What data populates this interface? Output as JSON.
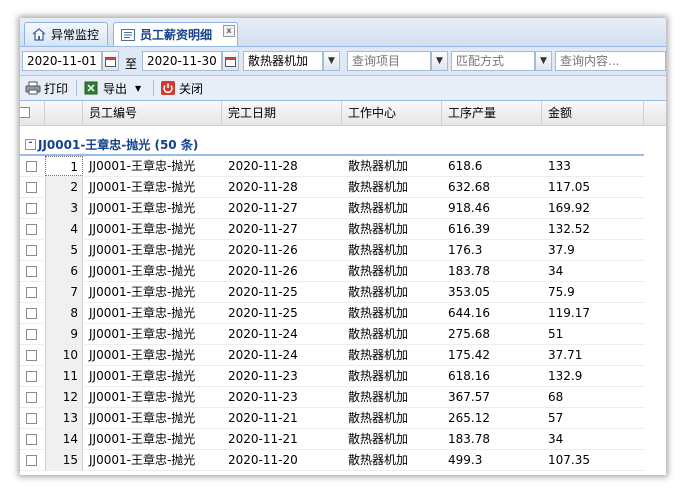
{
  "tabs": [
    {
      "label": "异常监控",
      "icon": "home-icon"
    },
    {
      "label": "员工薪资明细",
      "icon": "document-icon",
      "close": "x"
    }
  ],
  "filters": {
    "date_from": "2020-11-01",
    "to_label": "至",
    "date_to": "2020-11-30",
    "work_center": "散热器机加",
    "query_item_placeholder": "查询项目",
    "match_mode_placeholder": "匹配方式",
    "query_content_placeholder": "查询内容..."
  },
  "toolbar": {
    "print_label": "打印",
    "export_label": "导出",
    "close_label": "关闭"
  },
  "columns": [
    "员工编号",
    "完工日期",
    "工作中心",
    "工序产量",
    "金额"
  ],
  "group": {
    "label": "JJ0001-王章忠-抛光 (50 条)",
    "toggle": "-"
  },
  "rows": [
    {
      "n": "1",
      "emp": "JJ0001-王章忠-抛光",
      "date": "2020-11-28",
      "center": "散热器机加",
      "qty": "618.6",
      "amount": "133"
    },
    {
      "n": "2",
      "emp": "JJ0001-王章忠-抛光",
      "date": "2020-11-28",
      "center": "散热器机加",
      "qty": "632.68",
      "amount": "117.05"
    },
    {
      "n": "3",
      "emp": "JJ0001-王章忠-抛光",
      "date": "2020-11-27",
      "center": "散热器机加",
      "qty": "918.46",
      "amount": "169.92"
    },
    {
      "n": "4",
      "emp": "JJ0001-王章忠-抛光",
      "date": "2020-11-27",
      "center": "散热器机加",
      "qty": "616.39",
      "amount": "132.52"
    },
    {
      "n": "5",
      "emp": "JJ0001-王章忠-抛光",
      "date": "2020-11-26",
      "center": "散热器机加",
      "qty": "176.3",
      "amount": "37.9"
    },
    {
      "n": "6",
      "emp": "JJ0001-王章忠-抛光",
      "date": "2020-11-26",
      "center": "散热器机加",
      "qty": "183.78",
      "amount": "34"
    },
    {
      "n": "7",
      "emp": "JJ0001-王章忠-抛光",
      "date": "2020-11-25",
      "center": "散热器机加",
      "qty": "353.05",
      "amount": "75.9"
    },
    {
      "n": "8",
      "emp": "JJ0001-王章忠-抛光",
      "date": "2020-11-25",
      "center": "散热器机加",
      "qty": "644.16",
      "amount": "119.17"
    },
    {
      "n": "9",
      "emp": "JJ0001-王章忠-抛光",
      "date": "2020-11-24",
      "center": "散热器机加",
      "qty": "275.68",
      "amount": "51"
    },
    {
      "n": "10",
      "emp": "JJ0001-王章忠-抛光",
      "date": "2020-11-24",
      "center": "散热器机加",
      "qty": "175.42",
      "amount": "37.71"
    },
    {
      "n": "11",
      "emp": "JJ0001-王章忠-抛光",
      "date": "2020-11-23",
      "center": "散热器机加",
      "qty": "618.16",
      "amount": "132.9"
    },
    {
      "n": "12",
      "emp": "JJ0001-王章忠-抛光",
      "date": "2020-11-23",
      "center": "散热器机加",
      "qty": "367.57",
      "amount": "68"
    },
    {
      "n": "13",
      "emp": "JJ0001-王章忠-抛光",
      "date": "2020-11-21",
      "center": "散热器机加",
      "qty": "265.12",
      "amount": "57"
    },
    {
      "n": "14",
      "emp": "JJ0001-王章忠-抛光",
      "date": "2020-11-21",
      "center": "散热器机加",
      "qty": "183.78",
      "amount": "34"
    },
    {
      "n": "15",
      "emp": "JJ0001-王章忠-抛光",
      "date": "2020-11-20",
      "center": "散热器机加",
      "qty": "499.3",
      "amount": "107.35"
    }
  ]
}
